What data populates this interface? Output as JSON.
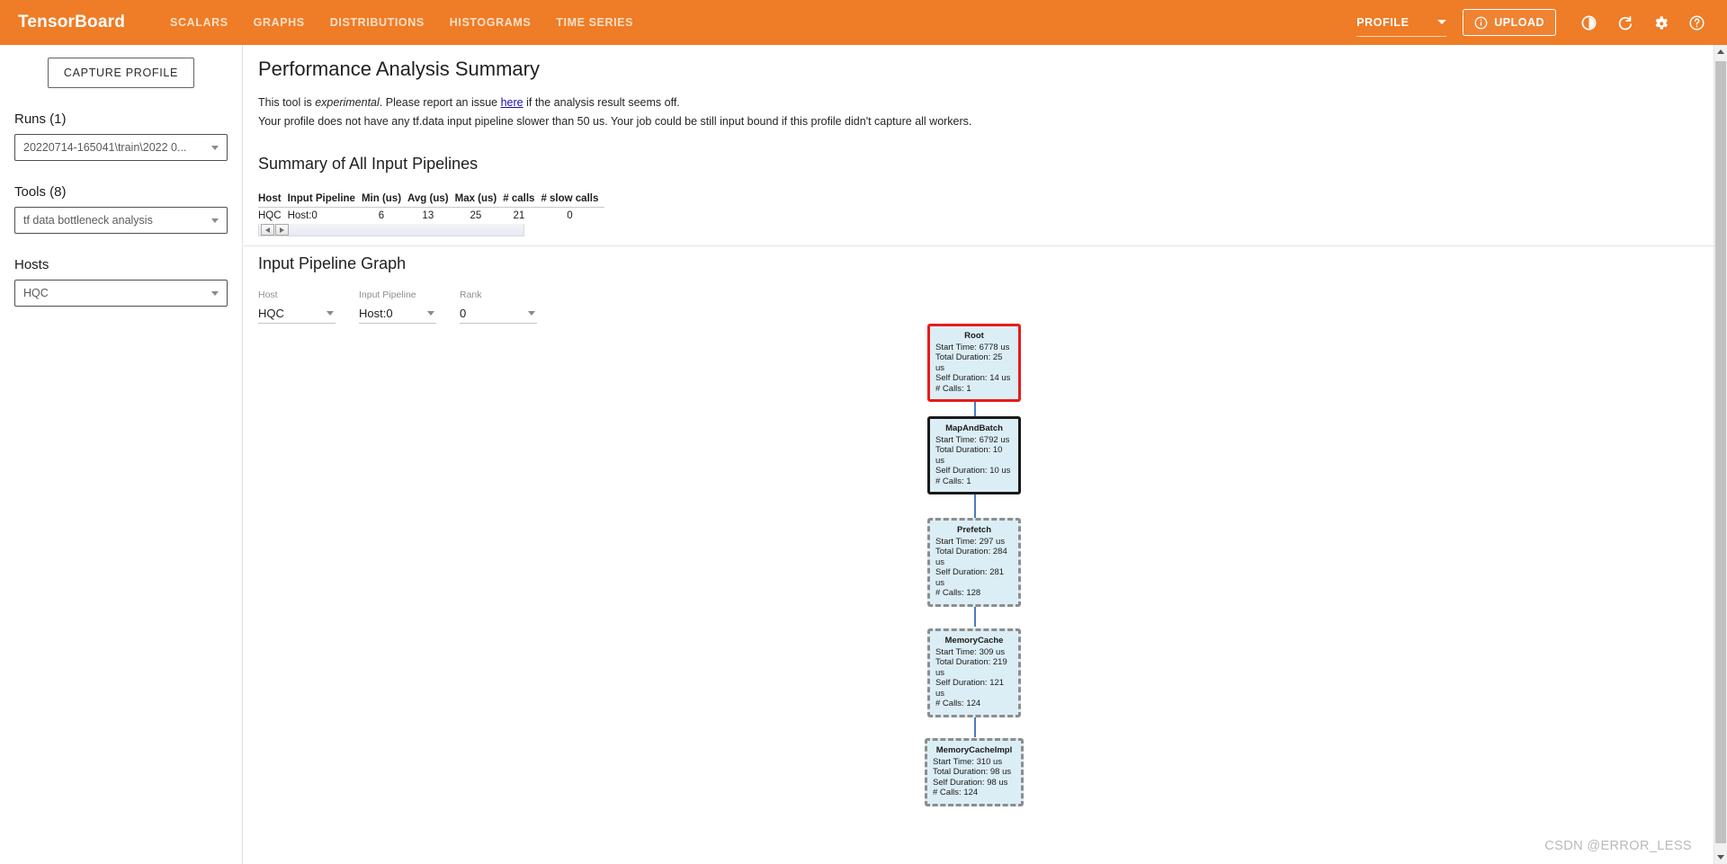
{
  "header": {
    "brand": "TensorBoard",
    "tabs": [
      {
        "label": "SCALARS"
      },
      {
        "label": "GRAPHS"
      },
      {
        "label": "DISTRIBUTIONS"
      },
      {
        "label": "HISTOGRAMS"
      },
      {
        "label": "TIME SERIES"
      }
    ],
    "active_plugin": "PROFILE",
    "upload_label": "UPLOAD",
    "icons": {
      "info": "info-icon",
      "dark_mode": "brightness-icon",
      "reload": "refresh-icon",
      "settings": "gear-icon",
      "help": "help-icon"
    },
    "accent_color": "#ef7c26"
  },
  "sidebar": {
    "capture_button": "CAPTURE PROFILE",
    "runs": {
      "label": "Runs (1)",
      "value": "20220714-165041\\train\\2022 0..."
    },
    "tools": {
      "label": "Tools (8)",
      "value": "tf data bottleneck analysis"
    },
    "hosts": {
      "label": "Hosts",
      "value": "HQC"
    }
  },
  "main": {
    "page_title": "Performance Analysis Summary",
    "note_line1_a": "This tool is ",
    "note_line1_em": "experimental",
    "note_line1_b": ". Please report an issue ",
    "note_line1_link": "here",
    "note_line1_c": " if the analysis result seems off.",
    "note_line2": "Your profile does not have any tf.data input pipeline slower than 50 us. Your job could be still input bound if this profile didn't capture all workers.",
    "summary_title": "Summary of All Input Pipelines",
    "summary_table": {
      "columns": [
        "Host",
        "Input Pipeline",
        "Min (us)",
        "Avg (us)",
        "Max (us)",
        "# calls",
        "# slow calls"
      ],
      "rows": [
        [
          "HQC",
          "Host:0",
          "6",
          "13",
          "25",
          "21",
          "0"
        ]
      ]
    },
    "graph_title": "Input Pipeline Graph",
    "controls": [
      {
        "label": "Host",
        "value": "HQC"
      },
      {
        "label": "Input Pipeline",
        "value": "Host:0"
      },
      {
        "label": "Rank",
        "value": "0"
      }
    ],
    "pipeline_nodes": [
      {
        "name": "Root",
        "start_time": "Start Time: 6778 us",
        "total_duration": "Total Duration: 25 us",
        "self_duration": "Self Duration: 14 us",
        "calls": "# Calls: 1",
        "style": "root"
      },
      {
        "name": "MapAndBatch",
        "start_time": "Start Time: 6792 us",
        "total_duration": "Total Duration: 10 us",
        "self_duration": "Self Duration: 10 us",
        "calls": "# Calls: 1",
        "style": "solid"
      },
      {
        "name": "Prefetch",
        "start_time": "Start Time: 297 us",
        "total_duration": "Total Duration: 284 us",
        "self_duration": "Self Duration: 281 us",
        "calls": "# Calls: 128",
        "style": "dashed"
      },
      {
        "name": "MemoryCache",
        "start_time": "Start Time: 309 us",
        "total_duration": "Total Duration: 219 us",
        "self_duration": "Self Duration: 121 us",
        "calls": "# Calls: 124",
        "style": "dashed"
      },
      {
        "name": "MemoryCacheImpl",
        "start_time": "Start Time: 310 us",
        "total_duration": "Total Duration: 98 us",
        "self_duration": "Self Duration: 98 us",
        "calls": "# Calls: 124",
        "style": "dashed"
      }
    ],
    "watermark": "CSDN @ERROR_LESS"
  }
}
